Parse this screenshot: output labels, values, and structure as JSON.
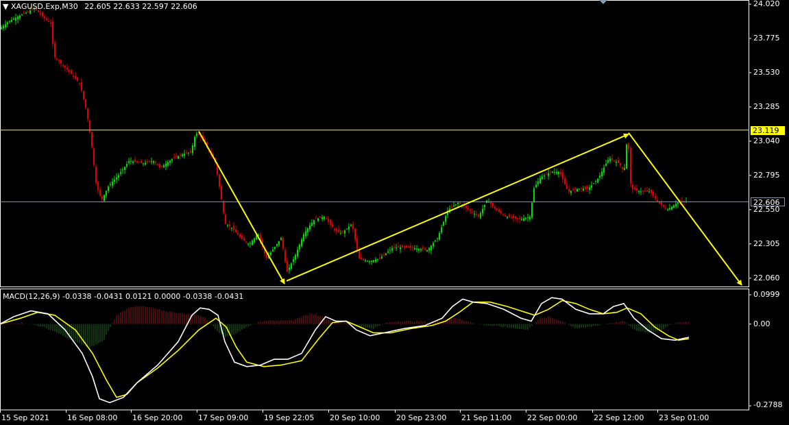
{
  "header": {
    "symbol": "XAGUSD.Exp,M30",
    "ohlc": "22.605 22.633 22.597 22.606",
    "macd_label": "MACD(12,26,9) -0.0338 -0.0431 0.0121 0.0000 -0.0338 -0.0431"
  },
  "price_axis": {
    "ticks": [
      "24.020",
      "23.775",
      "23.530",
      "23.285",
      "23.040",
      "22.795",
      "22.550",
      "22.305",
      "22.060"
    ],
    "ylim": [
      22.0,
      24.04
    ]
  },
  "macd_axis": {
    "ticks": [
      "0.0999",
      "0.00",
      "-0.2788"
    ],
    "ylim": [
      -0.2788,
      0.0999
    ]
  },
  "badges": {
    "resistance": "23.119",
    "current": "22.606"
  },
  "time_axis": {
    "labels": [
      "15 Sep 2021",
      "16 Sep 08:00",
      "16 Sep 20:00",
      "17 Sep 09:00",
      "19 Sep 22:05",
      "20 Sep 10:00",
      "20 Sep 23:00",
      "21 Sep 11:00",
      "22 Sep 00:00",
      "22 Sep 12:00",
      "23 Sep 01:00"
    ]
  },
  "colors": {
    "background": "#000000",
    "bull": "#00e000",
    "bear": "#e00000",
    "signal": "#ffff00",
    "macd_line": "#ffffff",
    "hist_pos": "#8b1a1a",
    "hist_neg": "#1f6b1f",
    "level_line": "#ffff00",
    "current_line": "#8a9aa8"
  },
  "chart_data": {
    "type": "candlestick",
    "series_price_path": [
      [
        0,
        23.84
      ],
      [
        15,
        23.9
      ],
      [
        40,
        23.96
      ],
      [
        52,
        23.99
      ],
      [
        64,
        23.93
      ],
      [
        76,
        23.88
      ],
      [
        80,
        23.65
      ],
      [
        100,
        23.55
      ],
      [
        118,
        23.45
      ],
      [
        128,
        23.25
      ],
      [
        135,
        23.02
      ],
      [
        142,
        22.72
      ],
      [
        150,
        22.62
      ],
      [
        160,
        22.72
      ],
      [
        175,
        22.8
      ],
      [
        190,
        22.9
      ],
      [
        210,
        22.88
      ],
      [
        225,
        22.9
      ],
      [
        235,
        22.85
      ],
      [
        255,
        22.92
      ],
      [
        270,
        22.95
      ],
      [
        280,
        22.96
      ],
      [
        287,
        23.1
      ],
      [
        295,
        23.07
      ],
      [
        305,
        22.98
      ],
      [
        315,
        22.9
      ],
      [
        322,
        22.7
      ],
      [
        330,
        22.45
      ],
      [
        340,
        22.42
      ],
      [
        352,
        22.35
      ],
      [
        365,
        22.3
      ],
      [
        378,
        22.38
      ],
      [
        390,
        22.2
      ],
      [
        405,
        22.3
      ],
      [
        412,
        22.35
      ],
      [
        420,
        22.1
      ],
      [
        432,
        22.22
      ],
      [
        445,
        22.38
      ],
      [
        460,
        22.48
      ],
      [
        475,
        22.5
      ],
      [
        490,
        22.4
      ],
      [
        500,
        22.38
      ],
      [
        515,
        22.45
      ],
      [
        525,
        22.2
      ],
      [
        540,
        22.18
      ],
      [
        555,
        22.2
      ],
      [
        575,
        22.28
      ],
      [
        600,
        22.28
      ],
      [
        625,
        22.26
      ],
      [
        640,
        22.35
      ],
      [
        655,
        22.55
      ],
      [
        670,
        22.6
      ],
      [
        685,
        22.55
      ],
      [
        700,
        22.5
      ],
      [
        712,
        22.62
      ],
      [
        725,
        22.55
      ],
      [
        740,
        22.5
      ],
      [
        760,
        22.48
      ],
      [
        775,
        22.5
      ],
      [
        780,
        22.7
      ],
      [
        790,
        22.78
      ],
      [
        805,
        22.82
      ],
      [
        818,
        22.82
      ],
      [
        830,
        22.68
      ],
      [
        845,
        22.7
      ],
      [
        860,
        22.7
      ],
      [
        875,
        22.78
      ],
      [
        890,
        22.92
      ],
      [
        905,
        22.88
      ],
      [
        912,
        22.82
      ],
      [
        917,
        23.1
      ],
      [
        922,
        22.7
      ],
      [
        935,
        22.68
      ],
      [
        950,
        22.68
      ],
      [
        962,
        22.6
      ],
      [
        975,
        22.55
      ],
      [
        990,
        22.6
      ],
      [
        1003,
        22.61
      ]
    ],
    "series_macd_path": [
      [
        0,
        0
      ],
      [
        20,
        0.025
      ],
      [
        45,
        0.045
      ],
      [
        70,
        0.035
      ],
      [
        95,
        -0.02
      ],
      [
        120,
        -0.1
      ],
      [
        135,
        -0.18
      ],
      [
        145,
        -0.255
      ],
      [
        160,
        -0.268
      ],
      [
        180,
        -0.25
      ],
      [
        200,
        -0.2
      ],
      [
        230,
        -0.14
      ],
      [
        260,
        -0.06
      ],
      [
        280,
        0.03
      ],
      [
        292,
        0.055
      ],
      [
        305,
        0.05
      ],
      [
        318,
        0.03
      ],
      [
        328,
        -0.06
      ],
      [
        342,
        -0.13
      ],
      [
        360,
        -0.145
      ],
      [
        380,
        -0.14
      ],
      [
        400,
        -0.12
      ],
      [
        420,
        -0.12
      ],
      [
        440,
        -0.1
      ],
      [
        460,
        -0.02
      ],
      [
        475,
        0.025
      ],
      [
        490,
        0.01
      ],
      [
        505,
        0.01
      ],
      [
        520,
        -0.02
      ],
      [
        540,
        -0.04
      ],
      [
        560,
        -0.03
      ],
      [
        590,
        -0.015
      ],
      [
        620,
        -0.005
      ],
      [
        645,
        0.02
      ],
      [
        660,
        0.06
      ],
      [
        675,
        0.085
      ],
      [
        690,
        0.075
      ],
      [
        710,
        0.07
      ],
      [
        735,
        0.05
      ],
      [
        760,
        0.02
      ],
      [
        775,
        0.01
      ],
      [
        790,
        0.07
      ],
      [
        805,
        0.09
      ],
      [
        820,
        0.085
      ],
      [
        840,
        0.05
      ],
      [
        860,
        0.035
      ],
      [
        880,
        0.035
      ],
      [
        895,
        0.06
      ],
      [
        910,
        0.07
      ],
      [
        925,
        0.02
      ],
      [
        945,
        -0.02
      ],
      [
        965,
        -0.05
      ],
      [
        985,
        -0.055
      ],
      [
        1005,
        -0.045
      ]
    ],
    "series_signal_path": [
      [
        0,
        0
      ],
      [
        30,
        0.02
      ],
      [
        55,
        0.04
      ],
      [
        80,
        0.03
      ],
      [
        110,
        -0.02
      ],
      [
        135,
        -0.1
      ],
      [
        155,
        -0.19
      ],
      [
        170,
        -0.25
      ],
      [
        185,
        -0.24
      ],
      [
        200,
        -0.2
      ],
      [
        230,
        -0.15
      ],
      [
        260,
        -0.09
      ],
      [
        290,
        -0.02
      ],
      [
        315,
        0.02
      ],
      [
        330,
        -0.01
      ],
      [
        345,
        -0.08
      ],
      [
        360,
        -0.13
      ],
      [
        385,
        -0.145
      ],
      [
        410,
        -0.14
      ],
      [
        440,
        -0.125
      ],
      [
        465,
        -0.05
      ],
      [
        485,
        0.005
      ],
      [
        505,
        0.01
      ],
      [
        525,
        -0.01
      ],
      [
        545,
        -0.03
      ],
      [
        570,
        -0.03
      ],
      [
        600,
        -0.015
      ],
      [
        630,
        -0.005
      ],
      [
        650,
        0.01
      ],
      [
        670,
        0.04
      ],
      [
        690,
        0.075
      ],
      [
        715,
        0.075
      ],
      [
        740,
        0.06
      ],
      [
        760,
        0.045
      ],
      [
        780,
        0.03
      ],
      [
        800,
        0.05
      ],
      [
        820,
        0.08
      ],
      [
        840,
        0.07
      ],
      [
        860,
        0.05
      ],
      [
        880,
        0.035
      ],
      [
        900,
        0.04
      ],
      [
        915,
        0.055
      ],
      [
        935,
        0.035
      ],
      [
        955,
        -0.01
      ],
      [
        975,
        -0.04
      ],
      [
        990,
        -0.055
      ],
      [
        1005,
        -0.05
      ]
    ],
    "series_histogram_path": [
      [
        0,
        0
      ],
      [
        30,
        0.005
      ],
      [
        55,
        -0.005
      ],
      [
        75,
        -0.02
      ],
      [
        100,
        -0.05
      ],
      [
        130,
        -0.08
      ],
      [
        150,
        -0.06
      ],
      [
        170,
        0.03
      ],
      [
        190,
        0.06
      ],
      [
        210,
        0.06
      ],
      [
        240,
        0.045
      ],
      [
        270,
        0.035
      ],
      [
        290,
        0.03
      ],
      [
        300,
        0.02
      ],
      [
        315,
        -0.02
      ],
      [
        330,
        -0.045
      ],
      [
        345,
        -0.03
      ],
      [
        360,
        -0.01
      ],
      [
        375,
        0.005
      ],
      [
        395,
        0.015
      ],
      [
        415,
        0.01
      ],
      [
        430,
        0.015
      ],
      [
        445,
        0.03
      ],
      [
        460,
        0.035
      ],
      [
        475,
        0.02
      ],
      [
        490,
        0.005
      ],
      [
        510,
        0.005
      ],
      [
        525,
        -0.01
      ],
      [
        545,
        -0.015
      ],
      [
        565,
        0.005
      ],
      [
        585,
        0.01
      ],
      [
        610,
        0.01
      ],
      [
        630,
        0.005
      ],
      [
        645,
        0.012
      ],
      [
        660,
        0.022
      ],
      [
        675,
        0.015
      ],
      [
        695,
        0.0
      ],
      [
        715,
        -0.005
      ],
      [
        735,
        -0.01
      ],
      [
        755,
        -0.015
      ],
      [
        770,
        -0.02
      ],
      [
        785,
        0.015
      ],
      [
        800,
        0.025
      ],
      [
        820,
        0.01
      ],
      [
        840,
        -0.015
      ],
      [
        860,
        -0.01
      ],
      [
        880,
        0.0
      ],
      [
        895,
        0.005
      ],
      [
        910,
        0.01
      ],
      [
        925,
        -0.02
      ],
      [
        945,
        -0.03
      ],
      [
        965,
        -0.02
      ],
      [
        985,
        0.005
      ],
      [
        1005,
        0.008
      ]
    ],
    "resistance_level": 23.119,
    "current_price": 22.606,
    "trend_arrows": [
      {
        "from": [
          290,
          23.11
        ],
        "to": [
          415,
          22.02
        ]
      },
      {
        "from": [
          418,
          22.04
        ],
        "to": [
          917,
          23.09
        ]
      },
      {
        "from": [
          917,
          23.1
        ],
        "to": [
          1082,
          22.01
        ]
      }
    ]
  }
}
